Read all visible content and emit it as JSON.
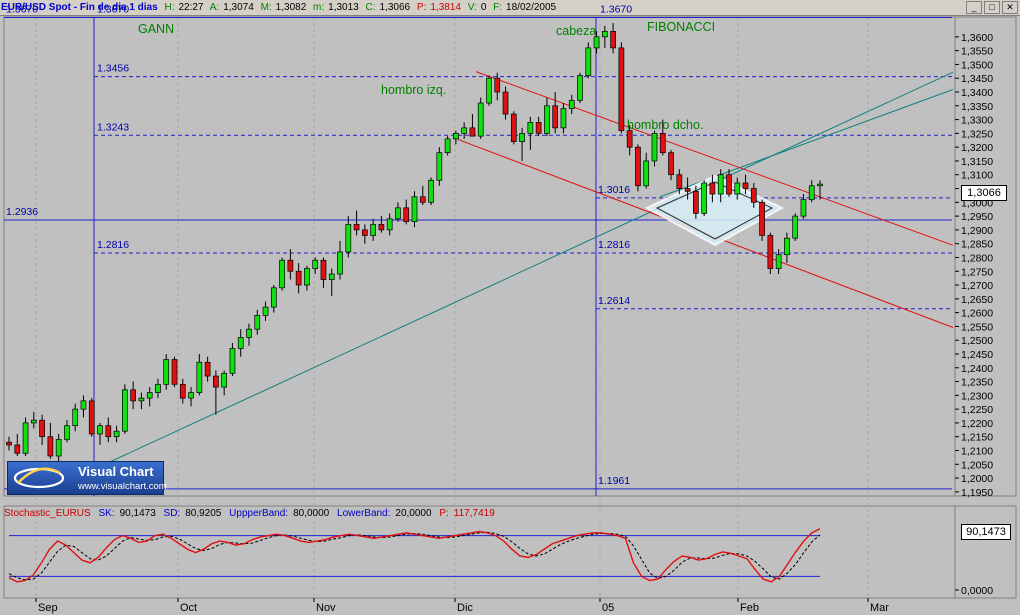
{
  "titlebar": {
    "name": "EUR/USD Spot - Fin de dia 1 dias",
    "h_label": "H:",
    "h_value": "22:27",
    "a_label": "A:",
    "a_value": "1,3074",
    "m_label": "M:",
    "m_value": "1,3082",
    "mn_label": "m:",
    "mn_value": "1,3013",
    "c_label": "C:",
    "c_value": "1,3066",
    "p_label": "P:",
    "p_value": "1,3814",
    "v_label": "V:",
    "v_value": "0",
    "f_label": "F:",
    "f_value": "18/02/2005",
    "btn_min": "_",
    "btn_max": "□",
    "btn_close": "✕"
  },
  "last_price": "1,3066",
  "stoch_last": "90,1473",
  "stoch_header": {
    "name": "Stochastic_EURUS",
    "sk_label": "SK:",
    "sk_value": "90,1473",
    "sd_label": "SD:",
    "sd_value": "80,9205",
    "up_label": "UppperBand:",
    "up_value": "80,0000",
    "low_label": "LowerBand:",
    "low_value": "20,0000",
    "p_label": "P:",
    "p_value": "117,7419"
  },
  "logo": {
    "title": "Visual Chart",
    "url": "www.visualchart.com"
  },
  "chart_data": [
    {
      "type": "candlestick",
      "y_ticks": [
        "1,3600",
        "1,3550",
        "1,3500",
        "1,3450",
        "1,3400",
        "1,3350",
        "1,3300",
        "1,3250",
        "1,3200",
        "1,3150",
        "1,3100",
        "1,3050",
        "1,3000",
        "1,2950",
        "1,2900",
        "1,2850",
        "1,2800",
        "1,2750",
        "1,2700",
        "1,2650",
        "1,2600",
        "1,2550",
        "1,2500",
        "1,2450",
        "1,2400",
        "1,2350",
        "1,2300",
        "1,2250",
        "1,2200",
        "1,2150",
        "1,2100",
        "1,2050",
        "1,2000",
        "1,1950"
      ],
      "ylim": [
        1.1935,
        1.3672
      ],
      "x_ticks": [
        "Sep",
        "Oct",
        "Nov",
        "Dic",
        "05",
        "Feb",
        "Mar"
      ],
      "levels": [
        {
          "label": "1.3670",
          "value": 1.367
        },
        {
          "label": "1.3456",
          "value": 1.3456
        },
        {
          "label": "1.3243",
          "value": 1.3243
        },
        {
          "label": "1.3016",
          "value": 1.3016
        },
        {
          "label": "1.2936",
          "value": 1.2936
        },
        {
          "label": "1.2816",
          "value": 1.2816
        },
        {
          "label": "1.2614",
          "value": 1.2614
        },
        {
          "label": "1.1961",
          "value": 1.1961
        }
      ],
      "annotations": [
        "GANN",
        "FIBONACCI",
        "cabeza",
        "hombro izq.",
        "hombro dcho."
      ],
      "ohlc": [
        [
          1.213,
          1.215,
          1.21,
          1.212
        ],
        [
          1.212,
          1.216,
          1.208,
          1.209
        ],
        [
          1.209,
          1.222,
          1.208,
          1.22
        ],
        [
          1.22,
          1.224,
          1.218,
          1.221
        ],
        [
          1.221,
          1.223,
          1.212,
          1.215
        ],
        [
          1.215,
          1.22,
          1.207,
          1.208
        ],
        [
          1.208,
          1.216,
          1.206,
          1.214
        ],
        [
          1.214,
          1.221,
          1.213,
          1.219
        ],
        [
          1.219,
          1.227,
          1.217,
          1.225
        ],
        [
          1.225,
          1.23,
          1.222,
          1.228
        ],
        [
          1.228,
          1.229,
          1.215,
          1.216
        ],
        [
          1.216,
          1.22,
          1.212,
          1.219
        ],
        [
          1.219,
          1.222,
          1.213,
          1.215
        ],
        [
          1.215,
          1.219,
          1.213,
          1.217
        ],
        [
          1.217,
          1.234,
          1.216,
          1.232
        ],
        [
          1.232,
          1.235,
          1.225,
          1.228
        ],
        [
          1.228,
          1.231,
          1.225,
          1.229
        ],
        [
          1.229,
          1.233,
          1.226,
          1.231
        ],
        [
          1.231,
          1.236,
          1.229,
          1.234
        ],
        [
          1.234,
          1.245,
          1.232,
          1.243
        ],
        [
          1.243,
          1.244,
          1.233,
          1.234
        ],
        [
          1.234,
          1.236,
          1.227,
          1.229
        ],
        [
          1.229,
          1.233,
          1.226,
          1.231
        ],
        [
          1.231,
          1.245,
          1.23,
          1.242
        ],
        [
          1.242,
          1.244,
          1.235,
          1.237
        ],
        [
          1.237,
          1.239,
          1.223,
          1.233
        ],
        [
          1.233,
          1.239,
          1.23,
          1.238
        ],
        [
          1.238,
          1.249,
          1.237,
          1.247
        ],
        [
          1.247,
          1.254,
          1.244,
          1.251
        ],
        [
          1.251,
          1.256,
          1.248,
          1.254
        ],
        [
          1.254,
          1.261,
          1.252,
          1.259
        ],
        [
          1.259,
          1.264,
          1.257,
          1.262
        ],
        [
          1.262,
          1.27,
          1.26,
          1.269
        ],
        [
          1.269,
          1.28,
          1.268,
          1.279
        ],
        [
          1.279,
          1.283,
          1.272,
          1.275
        ],
        [
          1.275,
          1.278,
          1.267,
          1.27
        ],
        [
          1.27,
          1.277,
          1.268,
          1.276
        ],
        [
          1.276,
          1.28,
          1.274,
          1.279
        ],
        [
          1.279,
          1.28,
          1.269,
          1.272
        ],
        [
          1.272,
          1.276,
          1.266,
          1.274
        ],
        [
          1.274,
          1.286,
          1.272,
          1.282
        ],
        [
          1.282,
          1.295,
          1.28,
          1.292
        ],
        [
          1.292,
          1.297,
          1.288,
          1.29
        ],
        [
          1.29,
          1.292,
          1.285,
          1.288
        ],
        [
          1.288,
          1.294,
          1.286,
          1.292
        ],
        [
          1.292,
          1.295,
          1.289,
          1.29
        ],
        [
          1.29,
          1.296,
          1.288,
          1.294
        ],
        [
          1.294,
          1.3,
          1.293,
          1.298
        ],
        [
          1.298,
          1.301,
          1.292,
          1.293
        ],
        [
          1.293,
          1.304,
          1.291,
          1.302
        ],
        [
          1.302,
          1.306,
          1.299,
          1.3
        ],
        [
          1.3,
          1.309,
          1.299,
          1.308
        ],
        [
          1.308,
          1.32,
          1.306,
          1.318
        ],
        [
          1.318,
          1.324,
          1.317,
          1.323
        ],
        [
          1.323,
          1.326,
          1.321,
          1.325
        ],
        [
          1.325,
          1.329,
          1.323,
          1.327
        ],
        [
          1.327,
          1.332,
          1.324,
          1.324
        ],
        [
          1.324,
          1.338,
          1.323,
          1.336
        ],
        [
          1.336,
          1.346,
          1.335,
          1.345
        ],
        [
          1.345,
          1.347,
          1.337,
          1.34
        ],
        [
          1.34,
          1.342,
          1.33,
          1.332
        ],
        [
          1.332,
          1.333,
          1.321,
          1.322
        ],
        [
          1.322,
          1.327,
          1.315,
          1.325
        ],
        [
          1.325,
          1.331,
          1.319,
          1.329
        ],
        [
          1.329,
          1.331,
          1.324,
          1.325
        ],
        [
          1.325,
          1.338,
          1.324,
          1.335
        ],
        [
          1.335,
          1.34,
          1.325,
          1.327
        ],
        [
          1.327,
          1.336,
          1.325,
          1.334
        ],
        [
          1.334,
          1.339,
          1.332,
          1.337
        ],
        [
          1.337,
          1.347,
          1.336,
          1.346
        ],
        [
          1.346,
          1.358,
          1.345,
          1.356
        ],
        [
          1.356,
          1.362,
          1.354,
          1.36
        ],
        [
          1.36,
          1.364,
          1.356,
          1.362
        ],
        [
          1.362,
          1.365,
          1.354,
          1.356
        ],
        [
          1.356,
          1.358,
          1.325,
          1.326
        ],
        [
          1.326,
          1.328,
          1.317,
          1.32
        ],
        [
          1.32,
          1.321,
          1.304,
          1.306
        ],
        [
          1.306,
          1.318,
          1.305,
          1.315
        ],
        [
          1.315,
          1.326,
          1.313,
          1.325
        ],
        [
          1.325,
          1.33,
          1.317,
          1.318
        ],
        [
          1.318,
          1.319,
          1.308,
          1.31
        ],
        [
          1.31,
          1.312,
          1.303,
          1.305
        ],
        [
          1.305,
          1.309,
          1.301,
          1.304
        ],
        [
          1.304,
          1.306,
          1.294,
          1.296
        ],
        [
          1.296,
          1.308,
          1.295,
          1.307
        ],
        [
          1.307,
          1.31,
          1.3,
          1.303
        ],
        [
          1.303,
          1.312,
          1.3,
          1.31
        ],
        [
          1.31,
          1.312,
          1.302,
          1.303
        ],
        [
          1.303,
          1.309,
          1.301,
          1.307
        ],
        [
          1.307,
          1.31,
          1.303,
          1.305
        ],
        [
          1.305,
          1.307,
          1.298,
          1.3
        ],
        [
          1.3,
          1.301,
          1.286,
          1.288
        ],
        [
          1.288,
          1.289,
          1.274,
          1.276
        ],
        [
          1.276,
          1.283,
          1.274,
          1.281
        ],
        [
          1.281,
          1.289,
          1.278,
          1.287
        ],
        [
          1.287,
          1.296,
          1.286,
          1.295
        ],
        [
          1.295,
          1.303,
          1.294,
          1.301
        ],
        [
          1.301,
          1.308,
          1.3,
          1.306
        ],
        [
          1.306,
          1.308,
          1.301,
          1.3066
        ]
      ],
      "stochastic": {
        "upper_band": 80.0,
        "lower_band": 20.0,
        "y_ticks": [
          "0,0000"
        ],
        "sk": [
          18,
          12,
          14,
          22,
          40,
          60,
          72,
          66,
          55,
          44,
          40,
          48,
          62,
          74,
          80,
          76,
          70,
          72,
          80,
          82,
          76,
          68,
          60,
          55,
          60,
          68,
          72,
          70,
          66,
          68,
          74,
          78,
          80,
          82,
          80,
          76,
          72,
          70,
          72,
          74,
          78,
          80,
          82,
          80,
          78,
          76,
          78,
          80,
          82,
          84,
          82,
          80,
          78,
          76,
          78,
          80,
          82,
          84,
          86,
          84,
          80,
          72,
          60,
          50,
          48,
          52,
          60,
          68,
          72,
          76,
          80,
          82,
          84,
          84,
          82,
          80,
          76,
          40,
          20,
          14,
          16,
          30,
          42,
          50,
          48,
          44,
          46,
          52,
          56,
          54,
          50,
          46,
          30,
          16,
          12,
          20,
          38,
          56,
          72,
          84,
          90.15
        ],
        "sd": [
          24,
          18,
          15,
          16,
          25,
          41,
          57,
          66,
          64,
          55,
          46,
          44,
          50,
          61,
          72,
          77,
          75,
          73,
          74,
          78,
          79,
          75,
          68,
          61,
          58,
          61,
          67,
          70,
          69,
          68,
          69,
          73,
          77,
          80,
          81,
          79,
          76,
          73,
          71,
          72,
          75,
          77,
          80,
          81,
          80,
          78,
          77,
          78,
          80,
          82,
          83,
          82,
          80,
          78,
          77,
          78,
          80,
          82,
          84,
          85,
          83,
          79,
          71,
          61,
          53,
          50,
          53,
          60,
          67,
          72,
          76,
          79,
          82,
          83,
          83,
          82,
          79,
          65,
          45,
          25,
          17,
          20,
          29,
          41,
          47,
          47,
          46,
          47,
          51,
          54,
          53,
          50,
          42,
          31,
          19,
          16,
          25,
          38,
          55,
          71,
          80.92
        ]
      }
    }
  ]
}
